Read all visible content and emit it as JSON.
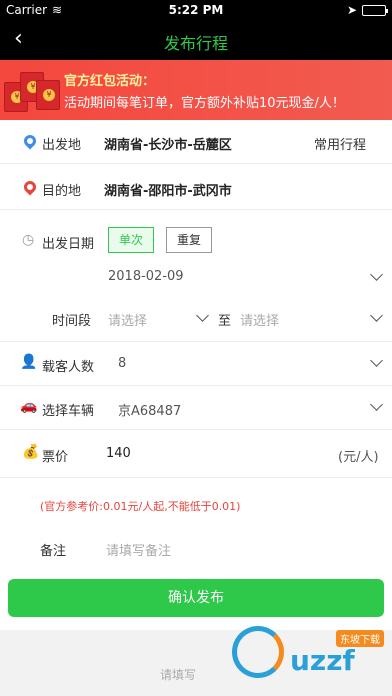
{
  "status": {
    "carrier": "Carrier",
    "time": "5:22 PM",
    "battery_level": 1.0
  },
  "nav": {
    "title": "发布行程",
    "back_icon": "chevron-left-icon"
  },
  "banner": {
    "headline": "官方红包活动：",
    "body": "活动期间每笔订单，官方额外补贴10元现金/人！"
  },
  "form": {
    "origin": {
      "label": "出发地",
      "value": "湖南省-长沙市-岳麓区",
      "action": "常用行程"
    },
    "destination": {
      "label": "目的地",
      "value": "湖南省-邵阳市-武冈市"
    },
    "date": {
      "label": "出发日期",
      "options": [
        "单次",
        "重复"
      ],
      "selected": "单次",
      "value": "2018-02-09"
    },
    "time_range": {
      "label": "时间段",
      "from_placeholder": "请选择",
      "separator": "至",
      "to_placeholder": "请选择"
    },
    "passengers": {
      "label": "载客人数",
      "value": "8"
    },
    "vehicle": {
      "label": "选择车辆",
      "value": "京A68487"
    },
    "price": {
      "label": "票价",
      "value": "140",
      "unit": "(元/人)"
    },
    "price_tip": "(官方参考价:0.01元/人起,不能低于0.01)",
    "remark": {
      "label": "备注",
      "placeholder": "请填写备注"
    }
  },
  "confirm_button": "确认发布",
  "bottom_hint": "请填写",
  "watermark": {
    "brand": "uzzf",
    "tag": "东坡下载"
  },
  "colors": {
    "accent": "#2ec84a",
    "banner": "#f4473d",
    "warning": "#e8453c",
    "origin_pin": "#3d8ee8",
    "dest_pin": "#e8453c"
  }
}
